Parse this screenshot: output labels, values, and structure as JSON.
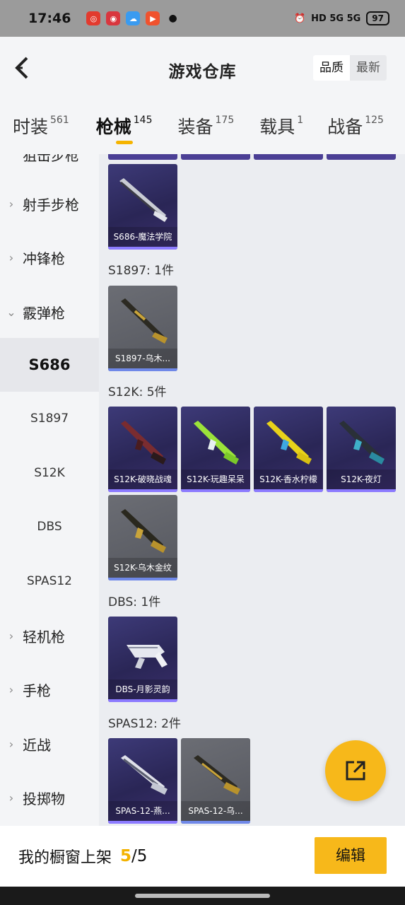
{
  "status_bar": {
    "time": "17:46",
    "network": "HD 5G 5G",
    "battery": "97"
  },
  "header": {
    "title": "游戏仓库",
    "sort_options": [
      "品质",
      "最新"
    ]
  },
  "tabs": [
    {
      "label": "时装",
      "count": "561"
    },
    {
      "label": "枪械",
      "count": "145"
    },
    {
      "label": "装备",
      "count": "175"
    },
    {
      "label": "载具",
      "count": "1"
    },
    {
      "label": "战备",
      "count": "125"
    }
  ],
  "sidebar": {
    "cut_label": "狙击步枪",
    "categories": [
      {
        "label": "射手步枪"
      },
      {
        "label": "冲锋枪"
      },
      {
        "label": "霰弹枪"
      }
    ],
    "subcategories": [
      "S686",
      "S1897",
      "S12K",
      "DBS",
      "SPAS12"
    ],
    "more_categories": [
      {
        "label": "轻机枪"
      },
      {
        "label": "手枪"
      },
      {
        "label": "近战"
      },
      {
        "label": "投掷物"
      }
    ]
  },
  "groups": [
    {
      "title": "S1897: 1件"
    },
    {
      "title": "S12K: 5件"
    },
    {
      "title": "DBS: 1件"
    },
    {
      "title": "SPAS12: 2件"
    }
  ],
  "cards": {
    "s686": [
      "S686-魔法学院"
    ],
    "s1897": [
      "S1897-乌木..."
    ],
    "s12k": [
      "S12K-破晓战魂",
      "S12K-玩趣呆呆",
      "S12K-香水柠檬",
      "S12K-夜灯",
      "S12K-乌木金纹"
    ],
    "dbs": [
      "DBS-月影灵韵"
    ],
    "spas12": [
      "SPAS-12-燕...",
      "SPAS-12-乌..."
    ]
  },
  "bottom": {
    "label": "我的橱窗上架",
    "count_current": "5",
    "count_sep_total": "/5",
    "edit_label": "编辑"
  },
  "colors": {
    "accent": "#f7b81a",
    "rarity_purple": "#3d3a78",
    "rarity_gray": "#6b6d74"
  },
  "icons": {
    "fab": "share-export-icon",
    "back": "back-arrow-icon"
  }
}
